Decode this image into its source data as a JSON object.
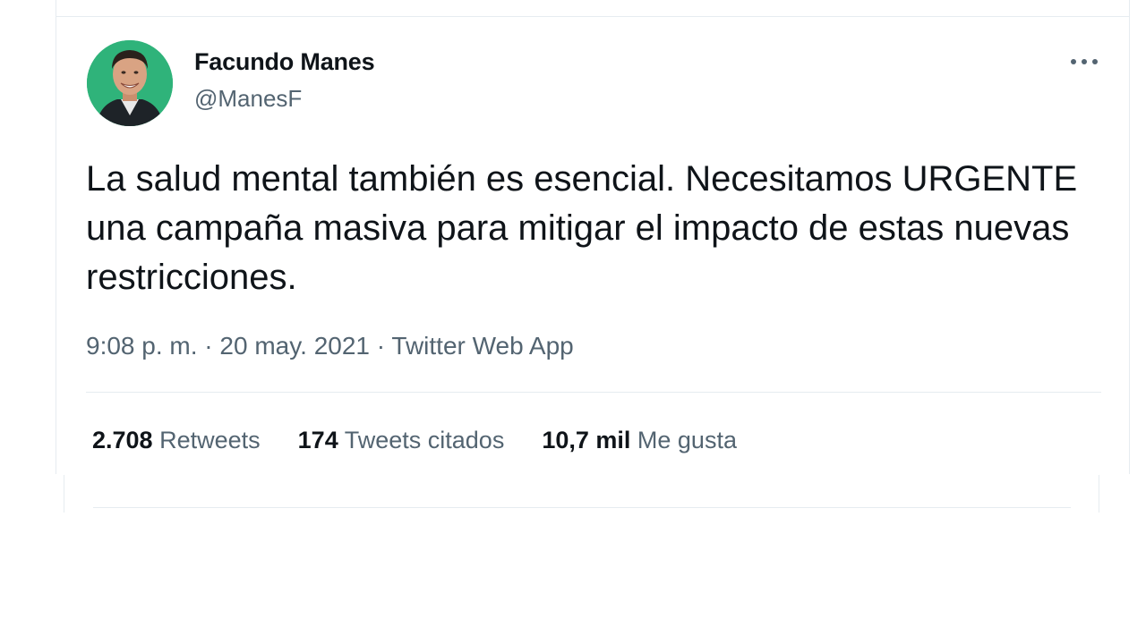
{
  "author": {
    "name": "Facundo Manes",
    "handle": "@ManesF"
  },
  "tweet": {
    "text": "La salud mental también es esencial. Necesitamos URGENTE una campaña masiva para mitigar el impacto de estas nuevas restricciones.",
    "time": "9:08 p. m.",
    "separator": "·",
    "date": "20 may. 2021",
    "source": "Twitter Web App"
  },
  "stats": {
    "retweets": {
      "count": "2.708",
      "label": "Retweets"
    },
    "quotes": {
      "count": "174",
      "label": "Tweets citados"
    },
    "likes": {
      "count": "10,7 mil",
      "label": "Me gusta"
    }
  },
  "icons": {
    "more": "more-options-icon"
  },
  "colors": {
    "text": "#0f1419",
    "secondary": "#536471",
    "border": "#e6ecf0",
    "avatar_bg": "#2fb37a"
  }
}
